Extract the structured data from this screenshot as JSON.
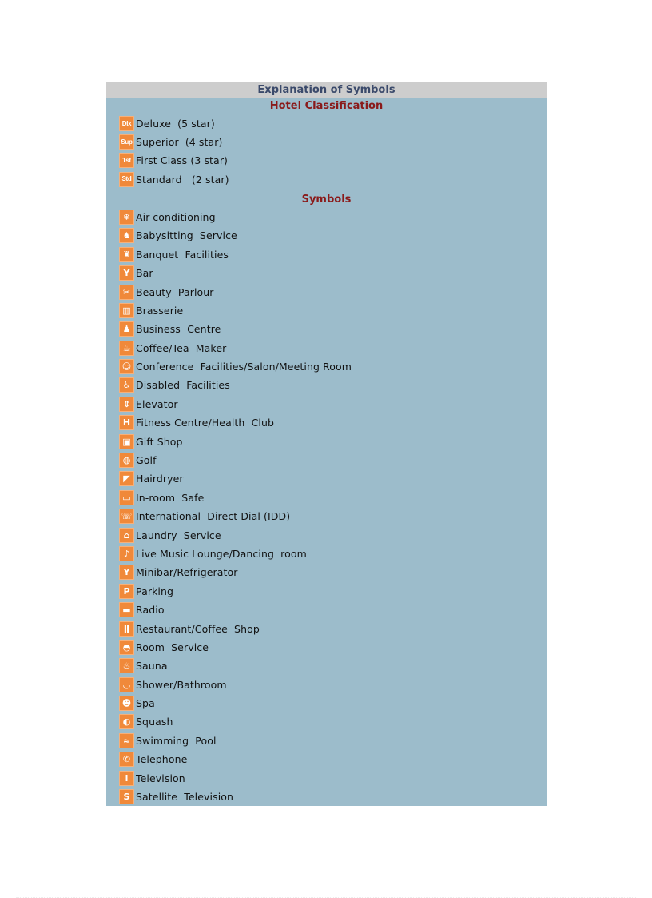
{
  "header": {
    "title": "Explanation of Symbols"
  },
  "classification": {
    "title": "Hotel Classification",
    "items": [
      {
        "icon": "deluxe-icon",
        "glyph": "Dlx",
        "label": "Deluxe  (5 star)"
      },
      {
        "icon": "superior-icon",
        "glyph": "Sup",
        "label": "Superior  (4 star)"
      },
      {
        "icon": "first-class-icon",
        "glyph": "1st",
        "label": "First Class (3 star)"
      },
      {
        "icon": "standard-icon",
        "glyph": "Std",
        "label": "Standard   (2 star)"
      }
    ]
  },
  "symbols": {
    "title": "Symbols",
    "items": [
      {
        "icon": "air-conditioning-icon",
        "glyph": "❄",
        "label": "Air-conditioning"
      },
      {
        "icon": "babysitting-icon",
        "glyph": "♞",
        "label": "Babysitting  Service"
      },
      {
        "icon": "banquet-icon",
        "glyph": "♜",
        "label": "Banquet  Facilities"
      },
      {
        "icon": "bar-icon",
        "glyph": "Y",
        "label": "Bar"
      },
      {
        "icon": "beauty-parlour-icon",
        "glyph": "✂",
        "label": "Beauty  Parlour"
      },
      {
        "icon": "brasserie-icon",
        "glyph": "▥",
        "label": "Brasserie"
      },
      {
        "icon": "business-centre-icon",
        "glyph": "♟",
        "label": "Business  Centre"
      },
      {
        "icon": "coffee-tea-maker-icon",
        "glyph": "☕",
        "label": "Coffee/Tea  Maker"
      },
      {
        "icon": "conference-icon",
        "glyph": "☺",
        "label": "Conference  Facilities/Salon/Meeting Room"
      },
      {
        "icon": "disabled-facilities-icon",
        "glyph": "♿",
        "label": "Disabled  Facilities"
      },
      {
        "icon": "elevator-icon",
        "glyph": "⇕",
        "label": "Elevator"
      },
      {
        "icon": "fitness-icon",
        "glyph": "H",
        "label": "Fitness Centre/Health  Club"
      },
      {
        "icon": "gift-shop-icon",
        "glyph": "▣",
        "label": "Gift Shop"
      },
      {
        "icon": "golf-icon",
        "glyph": "◍",
        "label": "Golf"
      },
      {
        "icon": "hairdryer-icon",
        "glyph": "◤",
        "label": "Hairdryer"
      },
      {
        "icon": "in-room-safe-icon",
        "glyph": "▭",
        "label": "In-room  Safe"
      },
      {
        "icon": "idd-icon",
        "glyph": "☏",
        "label": "International  Direct Dial (IDD)"
      },
      {
        "icon": "laundry-icon",
        "glyph": "⌂",
        "label": "Laundry  Service"
      },
      {
        "icon": "live-music-icon",
        "glyph": "♪",
        "label": "Live Music Lounge/Dancing  room"
      },
      {
        "icon": "minibar-icon",
        "glyph": "Y",
        "label": "Minibar/Refrigerator"
      },
      {
        "icon": "parking-icon",
        "glyph": "P",
        "label": "Parking"
      },
      {
        "icon": "radio-icon",
        "glyph": "▬",
        "label": "Radio"
      },
      {
        "icon": "restaurant-icon",
        "glyph": "ǁ",
        "label": "Restaurant/Coffee  Shop"
      },
      {
        "icon": "room-service-icon",
        "glyph": "◓",
        "label": "Room  Service"
      },
      {
        "icon": "sauna-icon",
        "glyph": "♨",
        "label": "Sauna"
      },
      {
        "icon": "shower-bathroom-icon",
        "glyph": "◡",
        "label": "Shower/Bathroom"
      },
      {
        "icon": "spa-icon",
        "glyph": "☻",
        "label": "Spa"
      },
      {
        "icon": "squash-icon",
        "glyph": "◐",
        "label": "Squash"
      },
      {
        "icon": "swimming-pool-icon",
        "glyph": "≈",
        "label": "Swimming  Pool"
      },
      {
        "icon": "telephone-icon",
        "glyph": "✆",
        "label": "Telephone"
      },
      {
        "icon": "television-icon",
        "glyph": "i",
        "label": "Television"
      },
      {
        "icon": "satellite-television-icon",
        "glyph": "S",
        "label": "Satellite  Television"
      }
    ]
  },
  "colors": {
    "header_bg": "#cdcdcd",
    "panel_bg": "#9cbccb",
    "header_text": "#3b4a6b",
    "section_title": "#8a1a1a",
    "icon_orange": "#f0893a"
  }
}
